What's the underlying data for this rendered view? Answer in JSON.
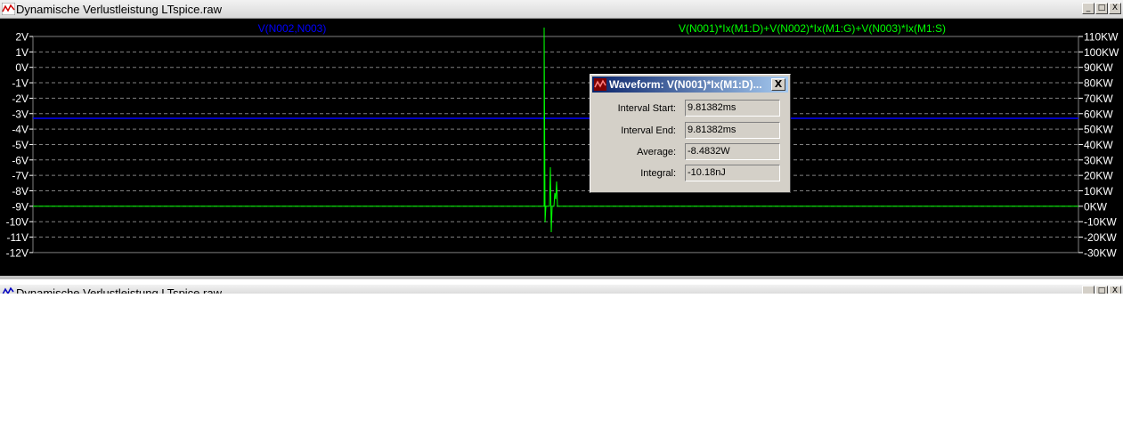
{
  "window": {
    "title": "Dynamische Verlustleistung LTspice.raw",
    "buttons": {
      "minimize": "_",
      "restore": "□",
      "close": "X"
    }
  },
  "plot": {
    "left_trace_label": "V(N002,N003)",
    "right_trace_label": "V(N001)*Ix(M1:D)+V(N002)*Ix(M1:G)+V(N003)*Ix(M1:S)",
    "colors": {
      "background": "#000000",
      "grid": "#808080",
      "left_trace": "#0000ff",
      "right_trace": "#00ff00",
      "axis_text": "#ffffff"
    }
  },
  "chart_data": {
    "type": "line",
    "left_axis": {
      "ticks": [
        "2V",
        "1V",
        "0V",
        "-1V",
        "-2V",
        "-3V",
        "-4V",
        "-5V",
        "-6V",
        "-7V",
        "-8V",
        "-9V",
        "-10V",
        "-11V",
        "-12V"
      ],
      "ylim": [
        -12,
        2
      ]
    },
    "right_axis": {
      "ticks": [
        "110KW",
        "100KW",
        "90KW",
        "80KW",
        "70KW",
        "60KW",
        "50KW",
        "40KW",
        "30KW",
        "20KW",
        "10KW",
        "0KW",
        "-10KW",
        "-20KW",
        "-30KW"
      ],
      "ylim": [
        -30,
        110
      ]
    },
    "grid": true,
    "series": [
      {
        "name": "V(N002,N003)",
        "axis": "left",
        "level": -3.3
      },
      {
        "name": "V(N001)*Ix(M1:D)+V(N002)*Ix(M1:G)+V(N003)*Ix(M1:S)",
        "axis": "right",
        "level": 0
      }
    ]
  },
  "dialog": {
    "title": "Waveform: V(N001)*Ix(M1:D)...",
    "close_label": "X",
    "rows": [
      {
        "label": "Interval Start:",
        "value": "9.81382ms"
      },
      {
        "label": "Interval End:",
        "value": "9.81382ms"
      },
      {
        "label": "Average:",
        "value": "-8.4832W"
      },
      {
        "label": "Integral:",
        "value": "-10.18nJ"
      }
    ]
  },
  "second_window": {
    "title": "Dynamische Verlustleistung LTspice.raw"
  }
}
